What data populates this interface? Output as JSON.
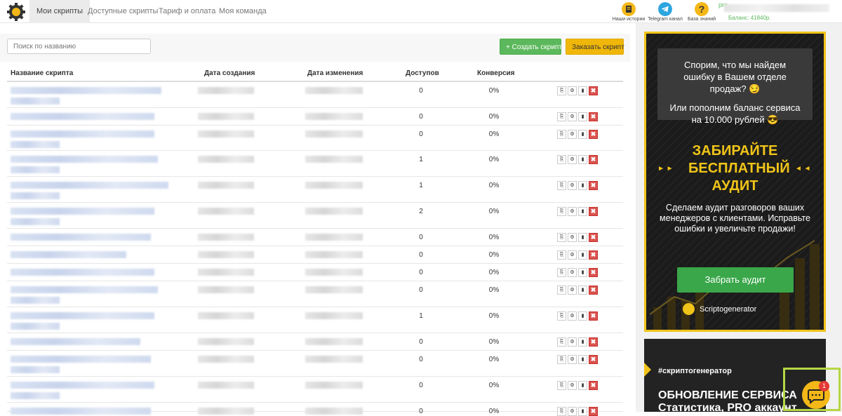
{
  "nav": {
    "tabs": [
      {
        "label": "Мои скрипты",
        "active": true
      },
      {
        "label": "Доступные скрипты"
      },
      {
        "label": "Тариф и оплата"
      },
      {
        "label": "Моя команда"
      }
    ]
  },
  "header": {
    "icons": [
      {
        "label": "Наши истории",
        "icon": "book-icon"
      },
      {
        "label": "Telegram канал",
        "icon": "telegram-icon"
      },
      {
        "label": "База знаний",
        "icon": "question-icon"
      }
    ],
    "user_name": "pro",
    "balance": "Баланс: 41840р."
  },
  "search": {
    "placeholder": "Поиск по названию"
  },
  "buttons": {
    "create": "+ Создать скрипт",
    "order": "Заказать скрипт"
  },
  "table": {
    "headers": [
      "Название скрипта",
      "Дата создания",
      "Дата изменения",
      "Доступов",
      "Конверсия"
    ],
    "rows": [
      {
        "access": "0",
        "conversion": "0%"
      },
      {
        "access": "0",
        "conversion": "0%"
      },
      {
        "access": "0",
        "conversion": "0%"
      },
      {
        "access": "1",
        "conversion": "0%"
      },
      {
        "access": "1",
        "conversion": "0%"
      },
      {
        "access": "2",
        "conversion": "0%"
      },
      {
        "access": "0",
        "conversion": "0%"
      },
      {
        "access": "0",
        "conversion": "0%"
      },
      {
        "access": "0",
        "conversion": "0%"
      },
      {
        "access": "0",
        "conversion": "0%"
      },
      {
        "access": "1",
        "conversion": "0%"
      },
      {
        "access": "0",
        "conversion": "0%"
      },
      {
        "access": "0",
        "conversion": "0%"
      },
      {
        "access": "0",
        "conversion": "0%"
      },
      {
        "access": "0",
        "conversion": "0%"
      }
    ]
  },
  "banner": {
    "bubble_line1": "Спорим, что мы найдем ошибку в Вашем отделе продаж? 😏",
    "bubble_line2": "Или пополним баланс сервиса на 10.000 рублей 😎",
    "title": "ЗАБИРАЙТЕ БЕСПЛАТНЫЙ АУДИТ",
    "text": "Сделаем аудит разговоров ваших менеджеров с клиентами. Исправьте ошибки и увеличьте продажи!",
    "button": "Забрать аудит",
    "brand": "Scriptogenerator"
  },
  "banner2": {
    "tag": "#скриптогенератор",
    "title": "ОБНОВЛЕНИЕ СЕРВИСА",
    "subtitle": "Статистика, PRO аккаунт"
  },
  "chat": {
    "badge": "1"
  },
  "colors": {
    "green": "#5cb85c",
    "yellow": "#f0b70a",
    "danger": "#d9534f",
    "banner_accent": "#f0c419"
  }
}
